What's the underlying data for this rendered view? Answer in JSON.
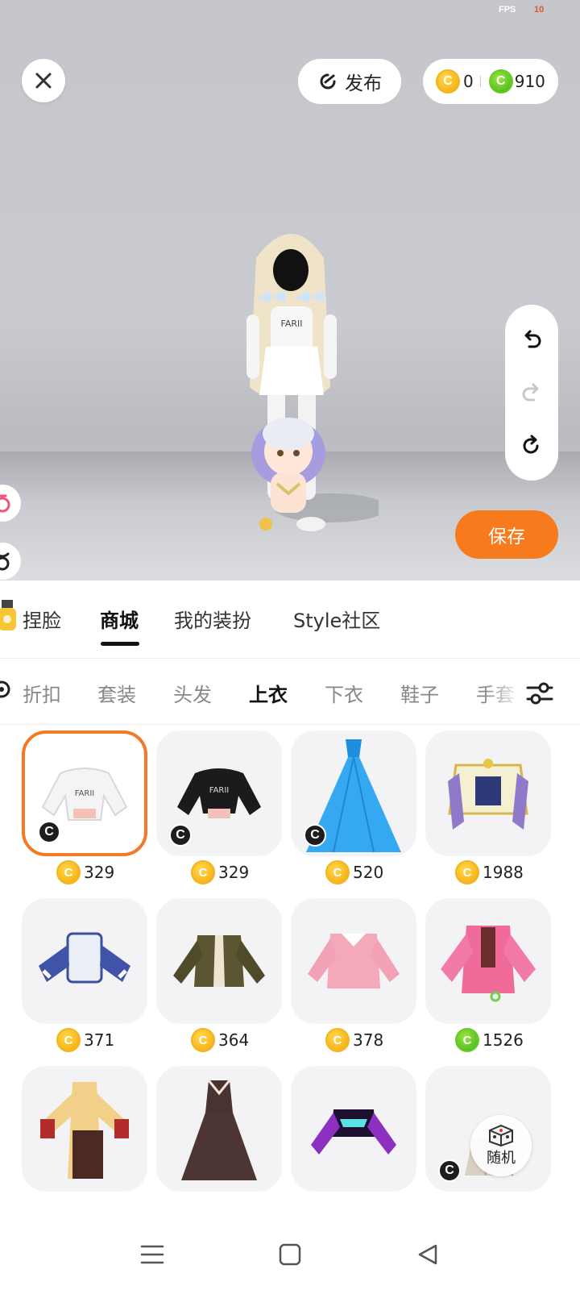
{
  "perf": {
    "label": "FPS",
    "value": "10"
  },
  "top": {
    "publish_label": "发布",
    "gold_amount": "0",
    "green_amount": "910",
    "coin_symbol": "C"
  },
  "actions": {
    "save_label": "保存",
    "random_label": "随机"
  },
  "main_tabs": [
    {
      "label": "捏脸",
      "active": false
    },
    {
      "label": "商城",
      "active": true
    },
    {
      "label": "我的装扮",
      "active": false
    },
    {
      "label": "Style社区",
      "active": false
    }
  ],
  "sub_tabs": [
    {
      "label": "折扣",
      "active": false
    },
    {
      "label": "套装",
      "active": false
    },
    {
      "label": "头发",
      "active": false
    },
    {
      "label": "上衣",
      "active": true
    },
    {
      "label": "下衣",
      "active": false
    },
    {
      "label": "鞋子",
      "active": false
    },
    {
      "label": "手套",
      "active": false
    }
  ],
  "items": [
    {
      "name": "white cropped hoodie",
      "price": "329",
      "currency": "gold",
      "badge": "C",
      "selected": true
    },
    {
      "name": "black cropped hoodie",
      "price": "329",
      "currency": "gold",
      "badge": "C",
      "selected": false
    },
    {
      "name": "blue ball gown",
      "price": "520",
      "currency": "gold",
      "badge": "C",
      "selected": false
    },
    {
      "name": "ornate gold top",
      "price": "1988",
      "currency": "gold",
      "badge": "",
      "selected": false
    },
    {
      "name": "blue striped sleeve top",
      "price": "371",
      "currency": "gold",
      "badge": "",
      "selected": false
    },
    {
      "name": "olive jacket",
      "price": "364",
      "currency": "gold",
      "badge": "",
      "selected": false
    },
    {
      "name": "pink sweater",
      "price": "378",
      "currency": "gold",
      "badge": "",
      "selected": false
    },
    {
      "name": "pink bomber jacket",
      "price": "1526",
      "currency": "green",
      "badge": "",
      "selected": false
    },
    {
      "name": "yellow qipao dress",
      "price": "",
      "currency": "",
      "badge": "",
      "selected": false
    },
    {
      "name": "dark brown dress",
      "price": "",
      "currency": "",
      "badge": "",
      "selected": false
    },
    {
      "name": "purple cropped jacket",
      "price": "",
      "currency": "",
      "badge": "",
      "selected": false
    },
    {
      "name": "beige pleated outfit",
      "price": "",
      "currency": "",
      "badge": "C",
      "selected": false
    }
  ],
  "colors": {
    "accent": "#f77a1c",
    "selected_border": "#f27a25",
    "gold": "#f4a60a",
    "green": "#3fb21d"
  }
}
